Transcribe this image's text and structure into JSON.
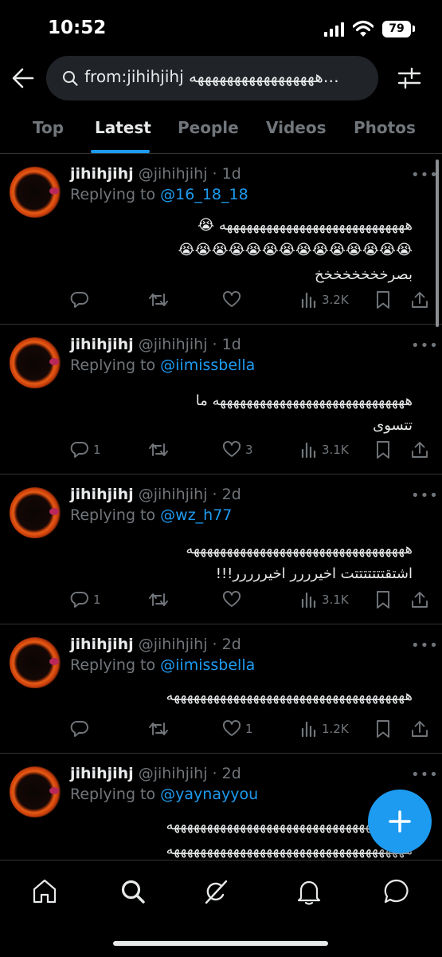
{
  "status_bar": {
    "time": "10:52",
    "battery": "79"
  },
  "search": {
    "query": "from:jihihjihj هههههههههههههههههه…"
  },
  "tabs": [
    {
      "label": "Top"
    },
    {
      "label": "Latest"
    },
    {
      "label": "People"
    },
    {
      "label": "Videos"
    },
    {
      "label": "Photos"
    }
  ],
  "active_tab": "Latest",
  "tweets": [
    {
      "name": "jihihjihj",
      "meta": "@jihihjihj · 1d",
      "replying_prefix": "Replying to ",
      "replying_to": "@16_18_18",
      "lines": [
        "ههههههههههههههههههههههههههههه 😭",
        "😭😭😭😭😭😭😭😭😭😭😭😭😭😭",
        "بصرخخخخخخخخ"
      ],
      "replies": "",
      "likes": "",
      "views": "3.2K"
    },
    {
      "name": "jihihjihj",
      "meta": "@jihihjihj · 1d",
      "replying_prefix": "Replying to ",
      "replying_to": "@iimissbella",
      "lines": [
        "هههههههههههههههههههههههههههههه ما",
        "تتسوى"
      ],
      "replies": "1",
      "likes": "3",
      "views": "3.1K"
    },
    {
      "name": "jihihjihj",
      "meta": "@jihihjihj · 2d",
      "replying_prefix": "Replying to ",
      "replying_to": "@wz_h77",
      "lines": [
        "هههههههههههههههههههههههههههههههههه",
        "اشتقتتتتتتتت اخيرررر اخيررررر!!!"
      ],
      "replies": "1",
      "likes": "",
      "views": "3.1K"
    },
    {
      "name": "jihihjihj",
      "meta": "@jihihjihj · 2d",
      "replying_prefix": "Replying to ",
      "replying_to": "@iimissbella",
      "lines": [
        "ههههههههههههههههههههههههههههههههههههه"
      ],
      "replies": "",
      "likes": "1",
      "views": "1.2K"
    },
    {
      "name": "jihihjihj",
      "meta": "@jihihjihj · 2d",
      "replying_prefix": "Replying to ",
      "replying_to": "@yaynayyou",
      "lines": [
        "ههههههههههههههههههههههههههههههههههههه",
        "ههههههههههههههههههههههههههههههههههههه"
      ],
      "replies": "",
      "likes": "",
      "views": ""
    }
  ],
  "icons": {
    "back": "arrow-left-icon",
    "search": "search-icon",
    "filter": "sliders-icon",
    "reply": "reply-icon",
    "retweet": "retweet-icon",
    "like": "heart-icon",
    "views": "bar-chart-icon",
    "bookmark": "bookmark-icon",
    "share": "share-icon",
    "compose": "plus-icon",
    "nav": [
      "home-icon",
      "search-icon",
      "grok-icon",
      "bell-icon",
      "messages-icon"
    ]
  },
  "colors": {
    "accent": "#1d9bf0",
    "background": "#000000",
    "muted": "#71767b",
    "text": "#e7e9ea"
  }
}
